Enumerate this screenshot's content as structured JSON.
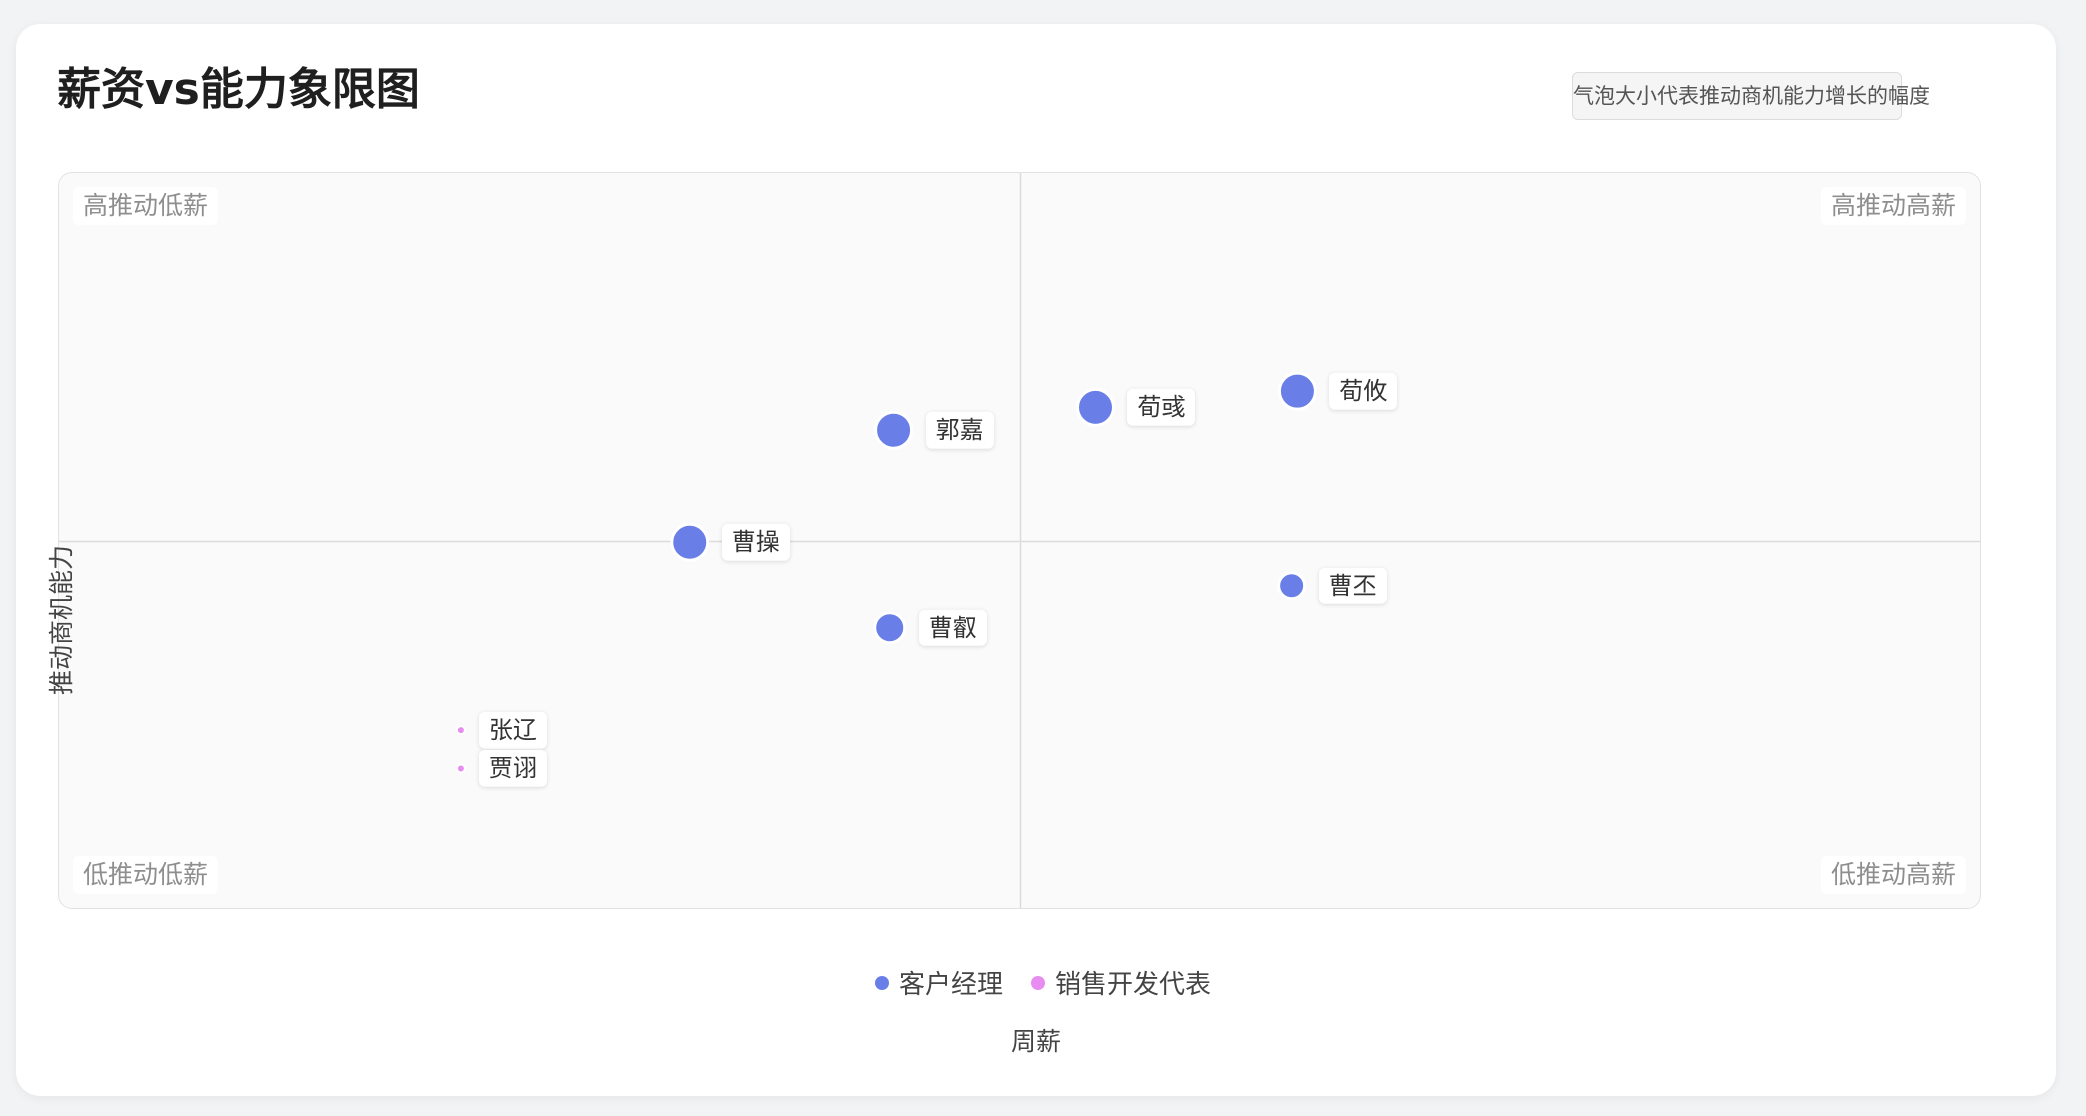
{
  "chart_data": {
    "type": "scatter",
    "title": "薪资vs能力象限图",
    "note": "气泡大小代表推动商机能力增长的幅度",
    "xlabel": "周薪",
    "ylabel": "推动商机能力",
    "xlim": [
      0,
      100
    ],
    "ylim": [
      0,
      100
    ],
    "grid": false,
    "legend_position": "bottom",
    "quadrant_labels": {
      "top_left": "高推动低薪",
      "top_right": "高推动高薪",
      "bottom_left": "低推动低薪",
      "bottom_right": "低推动高薪"
    },
    "series": [
      {
        "name": "客户经理",
        "color": "#6a7ee8",
        "points": [
          {
            "label": "郭嘉",
            "x": 43.4,
            "y": 65.1,
            "size": 18
          },
          {
            "label": "荀彧",
            "x": 53.9,
            "y": 68.2,
            "size": 18
          },
          {
            "label": "荀攸",
            "x": 64.4,
            "y": 70.4,
            "size": 18
          },
          {
            "label": "曹操",
            "x": 32.8,
            "y": 49.9,
            "size": 18
          },
          {
            "label": "曹丕",
            "x": 64.1,
            "y": 44.0,
            "size": 13
          },
          {
            "label": "曹叡",
            "x": 43.2,
            "y": 38.3,
            "size": 15
          }
        ]
      },
      {
        "name": "销售开发代表",
        "color": "#e78cf0",
        "points": [
          {
            "label": "张辽",
            "x": 20.9,
            "y": 24.4,
            "size": 4
          },
          {
            "label": "贾诩",
            "x": 20.9,
            "y": 19.2,
            "size": 4
          }
        ]
      }
    ]
  }
}
